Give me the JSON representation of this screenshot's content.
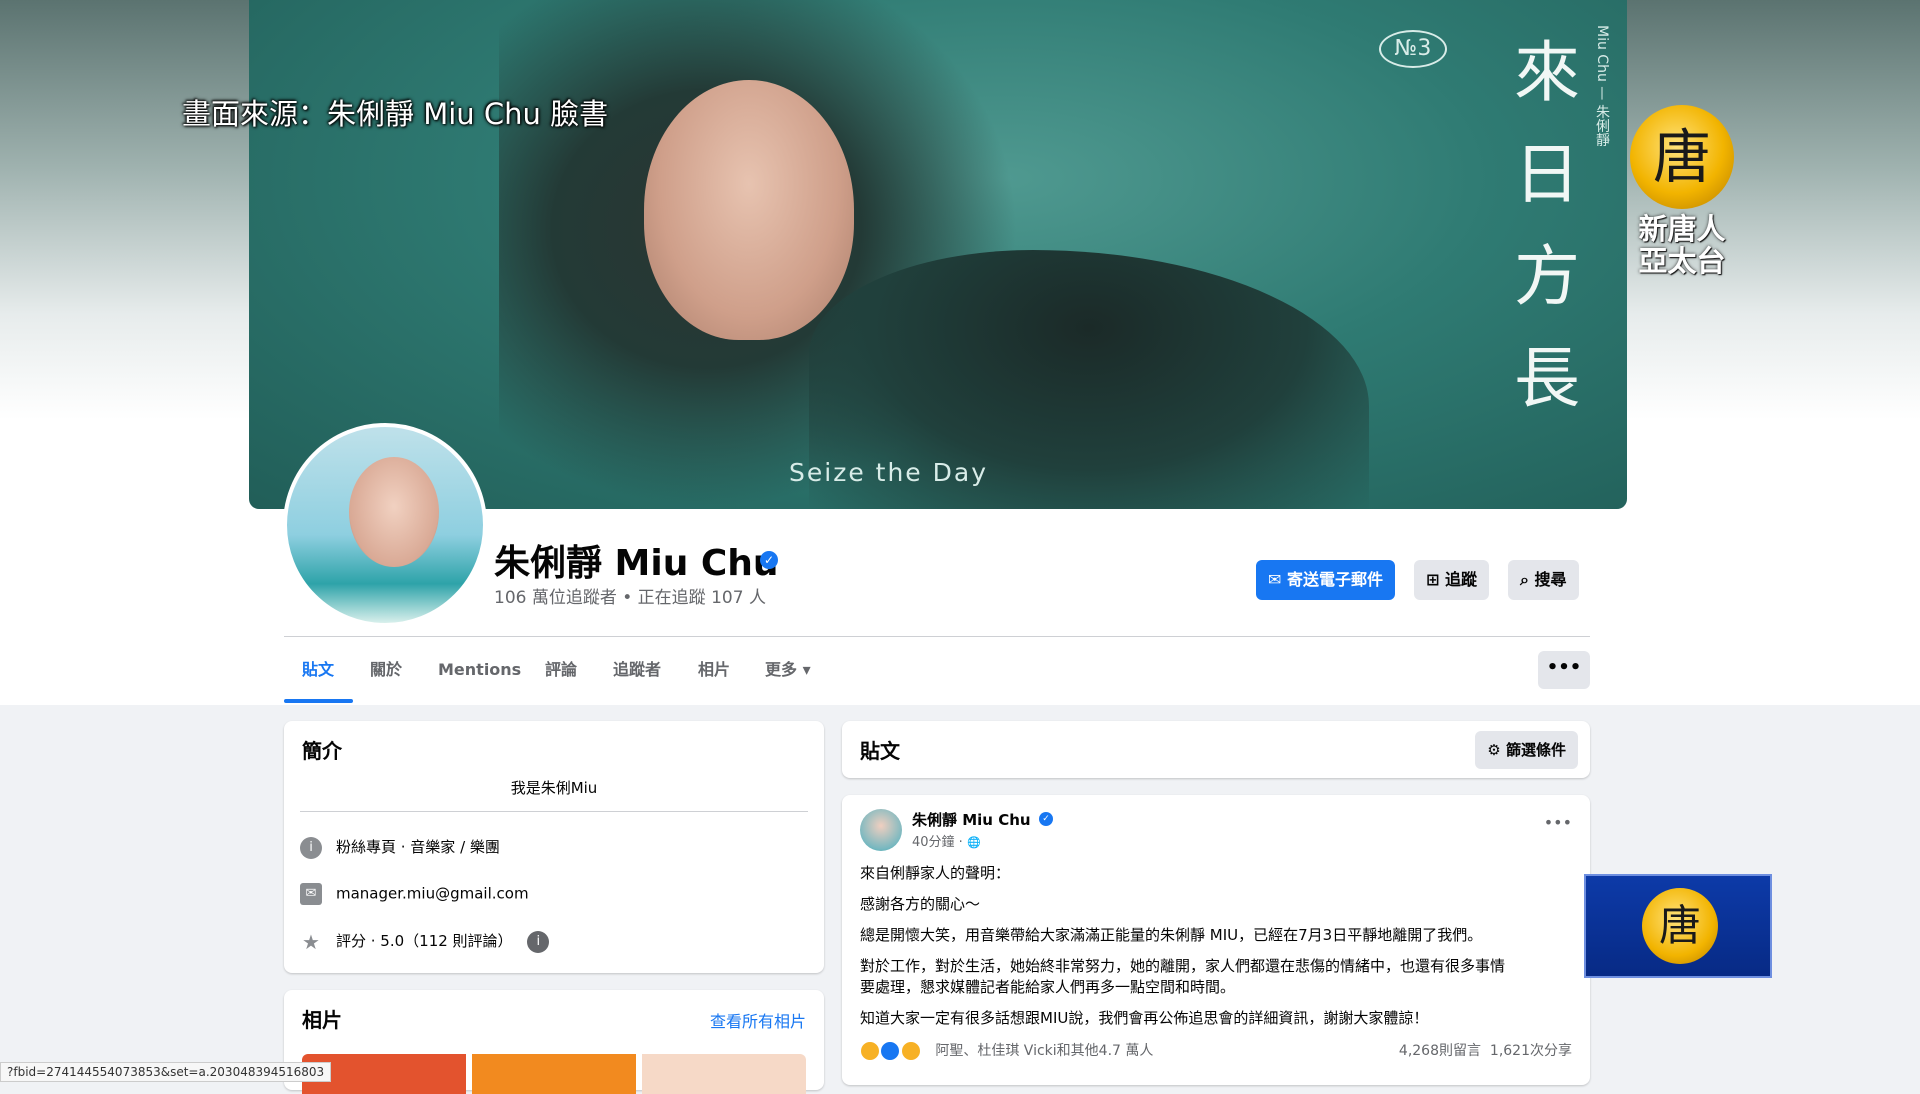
{
  "overlay": {
    "source_caption": "畫面來源：朱俐靜 Miu Chu 臉書",
    "ntd_logo_glyph": "唐",
    "ntd_logo_text_line1": "新唐人",
    "ntd_logo_text_line2": "亞太台",
    "ntd_corner_glyph": "唐"
  },
  "cover": {
    "no_label": "№3",
    "title_vertical": "來日方長",
    "artist_vertical": "Miu Chu — 朱俐靜",
    "tagline": "Seize the Day",
    "colors": {
      "background": "#2f7b73"
    }
  },
  "profile": {
    "name": "朱俐靜 Miu Chu",
    "verified_icon": "✓",
    "followers": "106 萬位追蹤者 • 正在追蹤 107 人"
  },
  "actions": {
    "email_label": "寄送電子郵件",
    "follow_label": "追蹤",
    "search_label": "搜尋",
    "email_icon": "✉",
    "follow_icon": "⊞",
    "search_icon": "⌕",
    "more_label": "•••"
  },
  "tabs": [
    {
      "label": "貼文",
      "active": true
    },
    {
      "label": "關於"
    },
    {
      "label": "Mentions"
    },
    {
      "label": "評論"
    },
    {
      "label": "追蹤者"
    },
    {
      "label": "相片"
    },
    {
      "label": "更多 ▾"
    }
  ],
  "intro": {
    "title": "簡介",
    "bio": "我是朱俐Miu",
    "category": "粉絲專頁 · 音樂家 / 樂團",
    "email": "manager.miu@gmail.com",
    "rating": "評分 · 5.0（112 則評論）",
    "info_icon": "i",
    "mail_icon": "✉",
    "star_icon": "★",
    "rating_info_icon": "i"
  },
  "photos": {
    "title": "相片",
    "see_all": "查看所有相片"
  },
  "posts_header": {
    "title": "貼文",
    "filter_label": "篩選條件",
    "filter_icon": "⚙"
  },
  "post": {
    "author": "朱俐靜 Miu Chu",
    "time": "40分鐘 · ",
    "globe_icon": "🌐",
    "more": "•••",
    "lines": [
      "來自俐靜家人的聲明：",
      "感謝各方的關心～",
      "總是開懷大笑，用音樂帶給大家滿滿正能量的朱俐靜 MIU，已經在7月3日平靜地離開了我們。",
      "對於工作，對於生活，她始終非常努力，她的離開，家人們都還在悲傷的情緒中，也還有很多事情",
      "要處理，懇求媒體記者能給家人們再多一點空間和時間。",
      "知道大家一定有很多話想跟MIU說，我們會再公佈追思會的詳細資訊，謝謝大家體諒！"
    ],
    "reactions": "阿聖、杜佳琪 Vicki和其他4.7 萬人",
    "comments": "4,268則留言",
    "shares": "1,621次分享"
  },
  "status_url": "?fbid=274144554073853&set=a.203048394516803"
}
